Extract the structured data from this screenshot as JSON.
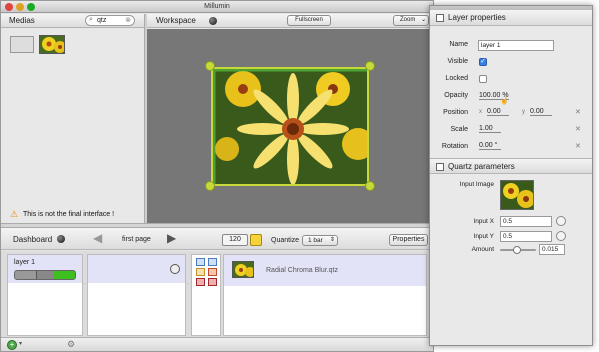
{
  "window": {
    "title": "Millumin"
  },
  "medias": {
    "title": "Medias",
    "search_value": "qtz",
    "warning": "This is not the final interface !"
  },
  "workspace": {
    "title": "Workspace",
    "fullscreen_label": "Fullscreen",
    "zoom_label": "Zoom"
  },
  "dashboard": {
    "title": "Dashboard",
    "page_label": "first page",
    "tempo_value": "120",
    "quantize_label": "Quantize",
    "quantize_value": "1 bar",
    "properties_label": "Properties",
    "layer_name": "layer 1",
    "effect_name": "Radial Chroma Blur.qtz"
  },
  "layer_properties": {
    "title": "Layer properties",
    "name_label": "Name",
    "name_value": "layer 1",
    "visible_label": "Visible",
    "locked_label": "Locked",
    "opacity_label": "Opacity",
    "opacity_value": "100.00 %",
    "position_label": "Position",
    "pos_x_label": "x",
    "pos_x_value": "0.00",
    "pos_y_label": "y",
    "pos_y_value": "0.00",
    "scale_label": "Scale",
    "scale_value": "1.00",
    "rotation_label": "Rotation",
    "rotation_value": "0.00 °"
  },
  "quartz_parameters": {
    "title": "Quartz parameters",
    "input_image_label": "Input Image",
    "input_x_label": "Input X",
    "input_x_value": "0.5",
    "input_y_label": "Input Y",
    "input_y_value": "0.5",
    "amount_label": "Amount",
    "amount_value": "0.015"
  },
  "colors": {
    "handle": "#c7d83a",
    "progress_green": "#3fbf1f",
    "selected_row": "#e3e3f7"
  }
}
